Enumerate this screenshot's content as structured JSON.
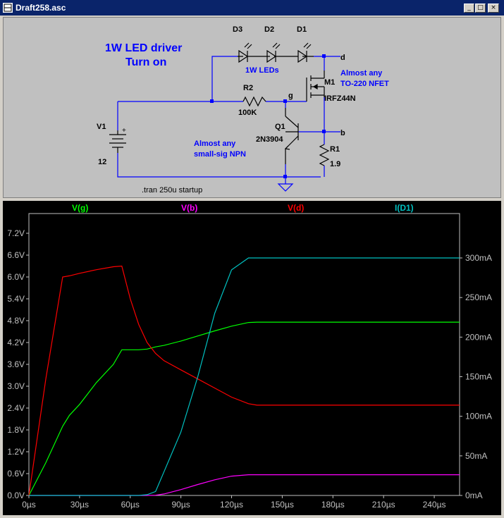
{
  "window": {
    "title": "Draft258.asc",
    "buttons": {
      "minimize": "_",
      "maximize": "□",
      "close": "×"
    }
  },
  "schematic": {
    "title_line1": "1W LED driver",
    "title_line2": "Turn on",
    "labels": {
      "D3": "D3",
      "D2": "D2",
      "D1": "D1",
      "leds": "1W LEDs",
      "M1": "M1",
      "M1_part": "IRFZ44N",
      "M1_note1": "Almost any",
      "M1_note2": "TO-220 NFET",
      "R2": "R2",
      "R2_val": "100K",
      "R1": "R1",
      "R1_val": "1.9",
      "Q1": "Q1",
      "Q1_part": "2N3904",
      "Q1_note1": "Almost any",
      "Q1_note2": "small-sig NPN",
      "V1": "V1",
      "V1_val": "12",
      "node_d": "d",
      "node_g": "g",
      "node_b": "b",
      "plus": "+",
      "directive": ".tran 250u startup"
    }
  },
  "plot": {
    "traces": {
      "g": "V(g)",
      "b": "V(b)",
      "d": "V(d)",
      "i": "I(D1)"
    },
    "colors": {
      "g": "#00ff00",
      "b": "#ff00ff",
      "d": "#ff0000",
      "i": "#00c0c0"
    },
    "y_left_ticks": [
      "7.2V",
      "6.6V",
      "6.0V",
      "5.4V",
      "4.8V",
      "4.2V",
      "3.6V",
      "3.0V",
      "2.4V",
      "1.8V",
      "1.2V",
      "0.6V",
      "0.0V"
    ],
    "y_right_ticks": [
      "300mA",
      "250mA",
      "200mA",
      "150mA",
      "100mA",
      "50mA",
      "0mA"
    ],
    "x_ticks": [
      "0µs",
      "30µs",
      "60µs",
      "90µs",
      "120µs",
      "150µs",
      "180µs",
      "210µs",
      "240µs"
    ]
  },
  "chart_data": {
    "type": "line",
    "xlabel": "",
    "ylabel": "",
    "xlim": [
      0,
      255
    ],
    "ylim": [
      0,
      7.2
    ],
    "ylim_right": [
      0,
      300
    ],
    "grid": false,
    "x": [
      0,
      10,
      20,
      24,
      30,
      40,
      50,
      55,
      60,
      65,
      70,
      75,
      80,
      90,
      100,
      110,
      120,
      130,
      135,
      150,
      180,
      210,
      240,
      255
    ],
    "series": [
      {
        "name": "V(g)",
        "axis": "left",
        "values": [
          0,
          0.9,
          1.9,
          2.2,
          2.5,
          3.1,
          3.6,
          4.0,
          4.0,
          4.0,
          4.02,
          4.08,
          4.12,
          4.24,
          4.38,
          4.52,
          4.65,
          4.75,
          4.76,
          4.76,
          4.76,
          4.76,
          4.76,
          4.76
        ]
      },
      {
        "name": "V(b)",
        "axis": "left",
        "values": [
          0,
          0,
          0,
          0,
          0,
          0,
          0,
          0,
          0,
          0,
          0,
          0.005,
          0.04,
          0.16,
          0.3,
          0.43,
          0.53,
          0.57,
          0.57,
          0.57,
          0.57,
          0.57,
          0.57,
          0.57
        ]
      },
      {
        "name": "V(d)",
        "axis": "left",
        "values": [
          0,
          3.2,
          6.0,
          6.03,
          6.1,
          6.2,
          6.28,
          6.3,
          5.4,
          4.7,
          4.2,
          3.9,
          3.7,
          3.45,
          3.2,
          2.95,
          2.7,
          2.52,
          2.48,
          2.48,
          2.48,
          2.48,
          2.48,
          2.48
        ]
      },
      {
        "name": "I(D1)",
        "axis": "right",
        "values": [
          0,
          0,
          0,
          0,
          0,
          0,
          0,
          0,
          0,
          0,
          1,
          5,
          30,
          80,
          150,
          230,
          285,
          300,
          300,
          300,
          300,
          300,
          300,
          300
        ]
      }
    ]
  }
}
